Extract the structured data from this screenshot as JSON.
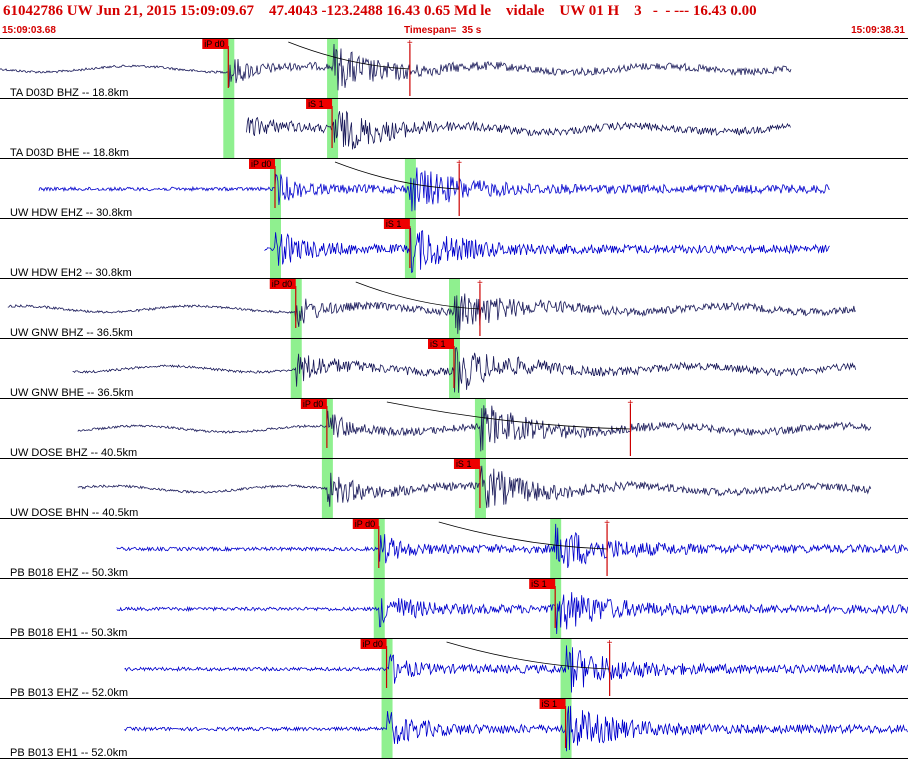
{
  "header": {
    "event_line": "61042786 UW Jun 21, 2015 15:09:09.67    47.4043 -123.2488 16.43 0.65 Md le    vidale    UW 01 H    3   -  - --- 16.43 0.00",
    "start_time": "15:09:03.68",
    "timespan_label": "Timespan=  35 s",
    "end_time": "15:09:38.31"
  },
  "colors": {
    "header_text": "#d40000",
    "pick_box": "#ee0000",
    "green_band": "#8ff08f",
    "trace_black": "#1a1a5a",
    "trace_blue": "#0000cc",
    "pick_line": "#cc0000",
    "divider": "#000000"
  },
  "chart_data": {
    "type": "seismogram-panel",
    "start_time": "15:09:03.68",
    "end_time": "15:09:38.31",
    "timespan_s": 35,
    "channels": [
      {
        "label": "TA D03D BHZ -- 18.8km",
        "pick": "iP d0",
        "pick_t": 8.8,
        "trace_start_t": 0.0,
        "trace_end_t": 30.5,
        "color": "black",
        "vertical": true,
        "s_t": 12.8,
        "end_marker_t": 15.8
      },
      {
        "label": "TA D03D BHE -- 18.8km",
        "pick": "iS 1",
        "pick_t": 12.6,
        "trace_start_t": 9.5,
        "trace_end_t": 30.5,
        "color": "black",
        "vertical": false,
        "s_t": 12.8
      },
      {
        "label": "UW HDW EHZ -- 30.8km",
        "pick": "iP d0",
        "pick_t": 10.6,
        "trace_start_t": 1.5,
        "trace_end_t": 32.0,
        "color": "blue",
        "vertical": true,
        "s_t": 15.8,
        "end_marker_t": 17.7
      },
      {
        "label": "UW HDW EH2 -- 30.8km",
        "pick": "iS 1",
        "pick_t": 15.6,
        "trace_start_t": 10.2,
        "trace_end_t": 32.0,
        "color": "blue",
        "vertical": false,
        "s_t": 15.8
      },
      {
        "label": "UW GNW BHZ -- 36.5km",
        "pick": "iP d0",
        "pick_t": 11.4,
        "trace_start_t": 0.3,
        "trace_end_t": 33.0,
        "color": "black",
        "vertical": true,
        "s_t": 17.5,
        "end_marker_t": 18.5
      },
      {
        "label": "UW GNW BHE -- 36.5km",
        "pick": "iS 1",
        "pick_t": 17.4,
        "trace_start_t": 2.8,
        "trace_end_t": 33.0,
        "color": "black",
        "vertical": false,
        "s_t": 17.5
      },
      {
        "label": "UW DOSE BHZ -- 40.5km",
        "pick": "iP d0",
        "pick_t": 12.6,
        "trace_start_t": 3.0,
        "trace_end_t": 33.6,
        "color": "black",
        "vertical": true,
        "s_t": 18.5,
        "end_marker_t": 24.3
      },
      {
        "label": "UW DOSE BHN -- 40.5km",
        "pick": "iS 1",
        "pick_t": 18.5,
        "trace_start_t": 3.0,
        "trace_end_t": 33.6,
        "color": "black",
        "vertical": false,
        "s_t": 18.5
      },
      {
        "label": "PB B018 EHZ -- 50.3km",
        "pick": "iP d0",
        "pick_t": 14.6,
        "trace_start_t": 4.5,
        "trace_end_t": 35.0,
        "color": "blue",
        "vertical": true,
        "s_t": 21.4,
        "end_marker_t": 23.4
      },
      {
        "label": "PB B018 EH1 -- 50.3km",
        "pick": "iS 1",
        "pick_t": 21.4,
        "trace_start_t": 4.5,
        "trace_end_t": 35.0,
        "color": "blue",
        "vertical": false,
        "s_t": 21.4
      },
      {
        "label": "PB B013 EHZ -- 52.0km",
        "pick": "iP d0",
        "pick_t": 14.9,
        "trace_start_t": 4.8,
        "trace_end_t": 35.0,
        "color": "blue",
        "vertical": true,
        "s_t": 21.8,
        "end_marker_t": 23.5
      },
      {
        "label": "PB B013 EH1 -- 52.0km",
        "pick": "iS 1",
        "pick_t": 21.7,
        "trace_start_t": 4.8,
        "trace_end_t": 35.0,
        "color": "blue",
        "vertical": false,
        "s_t": 21.8
      }
    ]
  }
}
